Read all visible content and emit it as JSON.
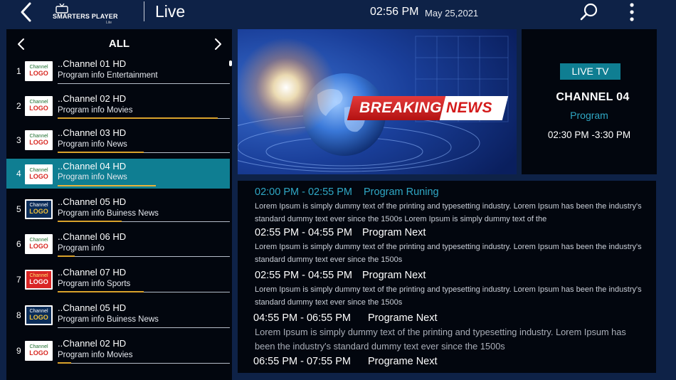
{
  "header": {
    "brand": "SMARTERS PLAYER",
    "brand_sub": "Lite",
    "title": "Live",
    "time": "02:56 PM",
    "date": "May 25,2021"
  },
  "category": {
    "title": "ALL"
  },
  "channels": [
    {
      "num": "1",
      "name": "..Channel 01 HD",
      "info": "Program info Entertainment",
      "logo_l1": "Channel",
      "logo_l2": "LOGO",
      "logo_style": "light",
      "progress": 0.0
    },
    {
      "num": "2",
      "name": "..Channel 02 HD",
      "info": "Program info Movies",
      "logo_l1": "Channel",
      "logo_l2": "LOGO",
      "logo_style": "light",
      "progress": 0.93
    },
    {
      "num": "3",
      "name": "..Channel 03 HD",
      "info": "Program info News",
      "logo_l1": "Channel",
      "logo_l2": "LOGO",
      "logo_style": "light",
      "progress": 0.5
    },
    {
      "num": "4",
      "name": "..Channel 04 HD",
      "info": "Program info News",
      "logo_l1": "Channel",
      "logo_l2": "LOGO",
      "logo_style": "light",
      "progress": 0.57
    },
    {
      "num": "5",
      "name": "..Channel 05 HD",
      "info": "Program info Buiness News",
      "logo_l1": "Channel",
      "logo_l2": "LOGO",
      "logo_style": "dark",
      "progress": 0.37
    },
    {
      "num": "6",
      "name": "..Channel 06 HD",
      "info": "Program info",
      "logo_l1": "Channel",
      "logo_l2": "LOGO",
      "logo_style": "light",
      "progress": 0.1
    },
    {
      "num": "7",
      "name": "..Channel 07 HD",
      "info": "Program info Sports",
      "logo_l1": "Channel",
      "logo_l2": "LOGO",
      "logo_style": "red",
      "progress": 0.5
    },
    {
      "num": "8",
      "name": "..Channel 05 HD",
      "info": "Program info Buiness News",
      "logo_l1": "Channel",
      "logo_l2": "LOGO",
      "logo_style": "dark",
      "progress": 0.0
    },
    {
      "num": "9",
      "name": "..Channel 02 HD",
      "info": "Program info Movies",
      "logo_l1": "Channel",
      "logo_l2": "LOGO",
      "logo_style": "light",
      "progress": 0.08
    }
  ],
  "selected_channel_index": 3,
  "player": {
    "breaking": "BREAKING",
    "news": "NEWS"
  },
  "now_playing": {
    "badge": "LIVE TV",
    "channel": "CHANNEL 04",
    "program": "Program",
    "time": "02:30 PM -3:30 PM"
  },
  "epg": [
    {
      "time": "02:00 PM -  02:55 PM",
      "title": "Program Runing",
      "running": true,
      "desc": "Lorem Ipsum is simply dummy text of the printing and typesetting industry. Lorem Ipsum has been the industry's standard dummy text ever since the 1500s Lorem Ipsum is simply dummy text of the"
    },
    {
      "time": "02:55 PM -  04:55 PM",
      "title": "Program Next",
      "running": false,
      "desc": "Lorem Ipsum is simply dummy text of the printing and typesetting industry. Lorem Ipsum has been the industry's standard dummy text ever since the 1500s"
    },
    {
      "time": "02:55 PM -  04:55 PM",
      "title": "Program Next",
      "running": false,
      "desc": "Lorem Ipsum is simply dummy text of the printing and typesetting industry. Lorem Ipsum has been the industry's standard dummy text ever since the 1500s"
    },
    {
      "time": "04:55 PM -  06:55 PM",
      "title": "Programe Next",
      "running": false,
      "desc": "Lorem Ipsum is simply dummy text of the printing and typesetting industry. Lorem Ipsum has been the industry's standard dummy text ever since the 1500s"
    },
    {
      "time": "06:55 PM -  07:55 PM",
      "title": "Programe Next",
      "running": false,
      "desc": ""
    }
  ],
  "colors": {
    "background": "#0e2247",
    "panel": "#02060e",
    "accent": "#0f7e92",
    "progress": "#d9a22b",
    "running_text": "#2fa7c4"
  },
  "icons": {
    "back": "chevron-left-icon",
    "tv": "tv-icon",
    "search": "search-icon",
    "more": "more-vertical-icon",
    "prev": "chevron-left-icon",
    "next": "chevron-right-icon"
  }
}
